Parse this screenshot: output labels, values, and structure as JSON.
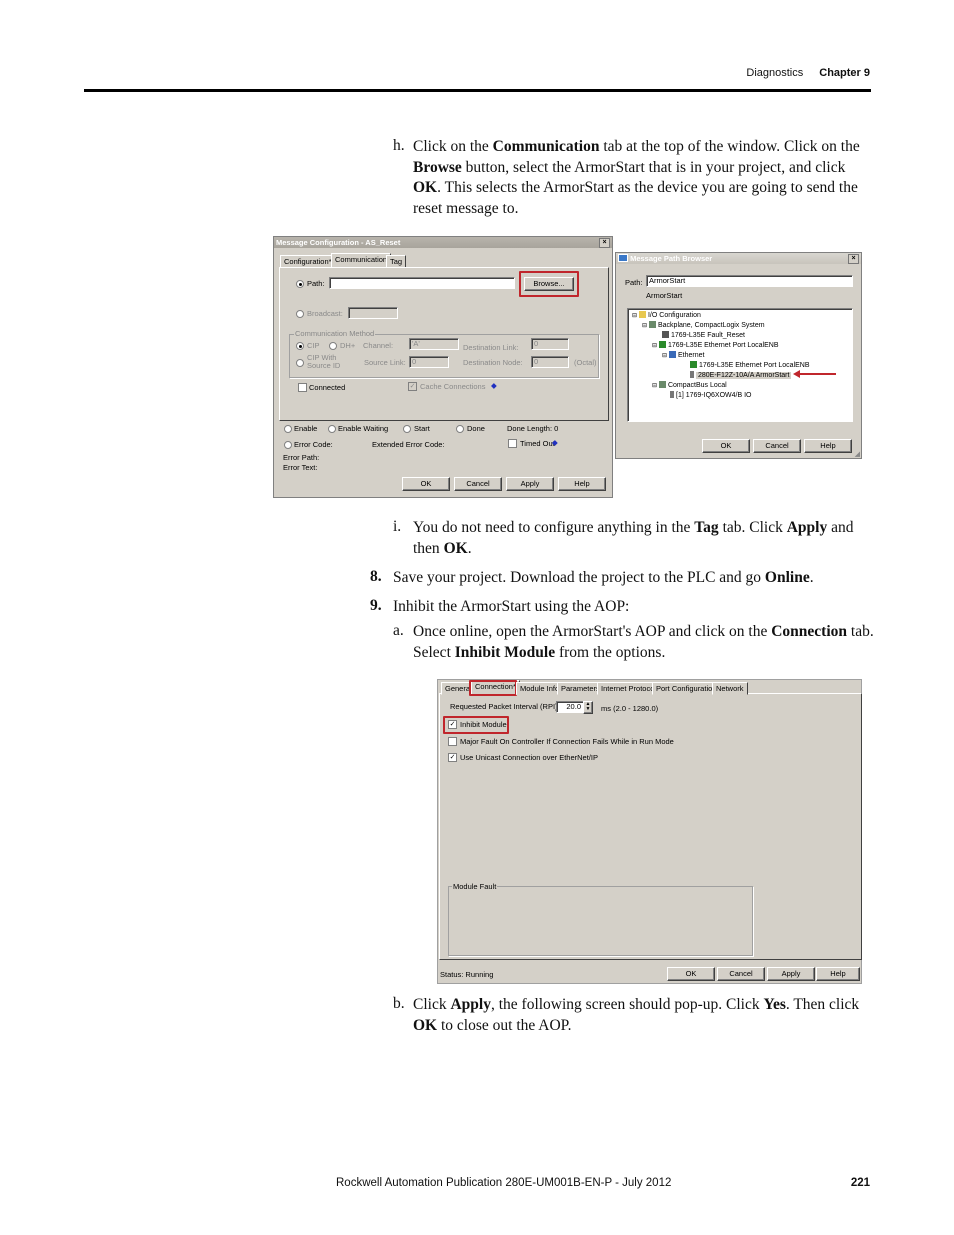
{
  "header": {
    "section": "Diagnostics",
    "chapter": "Chapter 9"
  },
  "steps": {
    "h": {
      "label": "h.",
      "parts": [
        "Click on the ",
        "Communication",
        " tab at the top of the window. Click on the ",
        "Browse",
        " button, select the ArmorStart that is in your project, and click ",
        "OK",
        ". This selects the ArmorStart as the device you are going to send the reset message to."
      ]
    },
    "i": {
      "label": "i.",
      "parts": [
        "You do not need to configure anything in the ",
        "Tag",
        " tab. Click ",
        "Apply",
        " and then ",
        "OK",
        "."
      ]
    },
    "s8": {
      "label": "8.",
      "parts": [
        "Save your project. Download the project to the PLC and go ",
        "Online",
        "."
      ]
    },
    "s9": {
      "label": "9.",
      "text": "Inhibit the ArmorStart using the AOP:"
    },
    "a": {
      "label": "a.",
      "parts": [
        "Once online, open the ArmorStart's AOP and click on the ",
        "Connection",
        " tab. Select ",
        "Inhibit Module",
        " from the options."
      ]
    },
    "b": {
      "label": "b.",
      "parts": [
        "Click ",
        "Apply",
        ", the following screen should pop-up. Click ",
        "Yes",
        ". Then click ",
        "OK",
        " to close out the AOP."
      ]
    }
  },
  "msg_config": {
    "title": "Message Configuration - AS_Reset",
    "tabs": [
      "Configuration*",
      "Communication",
      "Tag"
    ],
    "active_tab": "Communication",
    "path_label": "Path:",
    "path_value": "",
    "browse_label": "Browse...",
    "broadcast_label": "Broadcast:",
    "comm_method_title": "Communication Method",
    "cip_label": "CIP",
    "dhplus_label": "DH+",
    "channel_label": "Channel:",
    "channel_value": "'A'",
    "dest_link_label": "Destination Link:",
    "dest_link_value": "0",
    "cip_source_label": "CIP With Source ID",
    "source_link_label": "Source Link:",
    "source_link_value": "0",
    "dest_node_label": "Destination Node:",
    "dest_node_value": "0",
    "octal_label": "(Octal)",
    "connected_label": "Connected",
    "cache_label": "Cache Connections",
    "status": [
      "Enable",
      "Enable Waiting",
      "Start",
      "Done"
    ],
    "done_length_label": "Done Length: 0",
    "error_code_label": "Error Code:",
    "ext_error_label": "Extended Error Code:",
    "timed_out_label": "Timed Out",
    "error_path_label": "Error Path:",
    "error_text_label": "Error Text:",
    "buttons": [
      "OK",
      "Cancel",
      "Apply",
      "Help"
    ]
  },
  "path_browser": {
    "title": "Message Path Browser",
    "path_label": "Path:",
    "path_value": "ArmorStart",
    "path_resolved": "ArmorStart",
    "tree": [
      {
        "label": "I/O Configuration",
        "icon": "folder-icon"
      },
      {
        "label": "Backplane, CompactLogix System",
        "icon": "backplane-icon"
      },
      {
        "label": "1769-L35E Fault_Reset",
        "icon": "controller-icon"
      },
      {
        "label": "1769-L35E Ethernet Port LocalENB",
        "icon": "ethernet-port-icon"
      },
      {
        "label": "Ethernet",
        "icon": "network-icon"
      },
      {
        "label": "1769-L35E Ethernet Port LocalENB",
        "icon": "ethernet-port-icon"
      },
      {
        "label": "280E-F12Z-10A/A ArmorStart",
        "icon": "module-icon",
        "selected": true
      },
      {
        "label": "CompactBus Local",
        "icon": "backplane-icon"
      },
      {
        "label": "[1] 1769-IQ6XOW4/B IO",
        "icon": "module-icon"
      }
    ],
    "buttons": [
      "OK",
      "Cancel",
      "Help"
    ]
  },
  "aop": {
    "tabs": [
      "General",
      "Connection*",
      "Module Info",
      "Parameters",
      "Internet Protocol",
      "Port Configuration",
      "Network"
    ],
    "active_tab": "Connection*",
    "rpi_label": "Requested Packet Interval (RPI):",
    "rpi_value": "20.0",
    "rpi_range": "ms (2.0 - 1280.0)",
    "inhibit_label": "Inhibit Module",
    "inhibit_checked": true,
    "major_fault_label": "Major Fault On Controller If Connection Fails While in Run Mode",
    "major_fault_checked": false,
    "unicast_label": "Use Unicast Connection over EtherNet/IP",
    "unicast_checked": true,
    "module_fault_title": "Module Fault",
    "status_text": "Status:  Running",
    "buttons": [
      "OK",
      "Cancel",
      "Apply",
      "Help"
    ]
  },
  "footer": {
    "publication": "Rockwell Automation Publication 280E-UM001B-EN-P - July 2012",
    "page": "221"
  },
  "colors": {
    "highlight": "#c0262c",
    "dialog_bg": "#d4d0c8"
  }
}
